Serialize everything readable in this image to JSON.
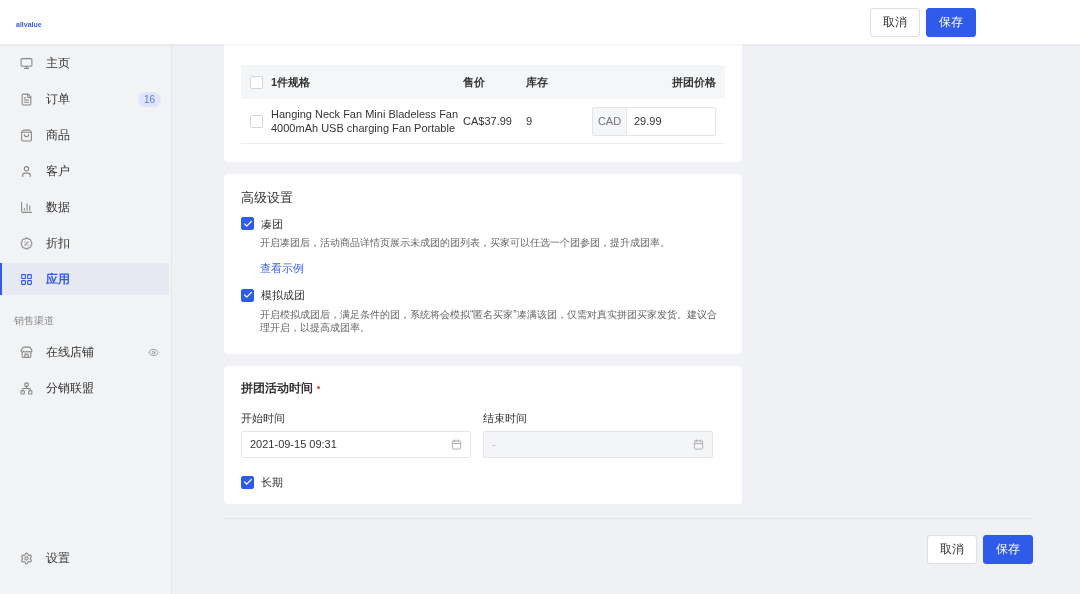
{
  "logo": "allvalue",
  "header_buttons": [
    {
      "label": "取消",
      "kind": "secondary"
    },
    {
      "label": "保存",
      "kind": "primary"
    }
  ],
  "sidebar": {
    "items": [
      {
        "label": "主页",
        "selected": false
      },
      {
        "label": "订单",
        "selected": false,
        "badge": "16"
      },
      {
        "label": "商品",
        "selected": false
      },
      {
        "label": "客户",
        "selected": false
      },
      {
        "label": "数据",
        "selected": false
      },
      {
        "label": "折扣",
        "selected": false
      },
      {
        "label": "应用",
        "selected": true
      }
    ],
    "section_label": "销售渠道",
    "channels": [
      {
        "label": "在线店铺",
        "visible_toggle": true
      },
      {
        "label": "分销联盟",
        "visible_toggle": false
      }
    ],
    "settings": "设置"
  },
  "price_table": {
    "columns": [
      "1件规格",
      "售价",
      "库存",
      "拼团价格"
    ],
    "header_checked": false,
    "rows": [
      {
        "checked": false,
        "name": "Hanging Neck Fan Mini Bladeless Fan 4000mAh USB charging Fan Portable",
        "price": "CA$37.99",
        "stock": "9",
        "currency": "CAD",
        "group_price": "29.99"
      }
    ]
  },
  "advanced": {
    "title": "高级设置",
    "options": [
      {
        "label": "凑团",
        "checked": true,
        "description": "开启凑团后，活动商品详情页展示未成团的团列表，买家可以任选一个团参团，提升成团率。",
        "link": "查看示例"
      },
      {
        "label": "模拟成团",
        "checked": true,
        "description": "开启模拟成团后，满足条件的团，系统将会模拟“匿名买家”凑满该团，仅需对真实拼团买家发货。建议合理开启，以提高成团率。"
      }
    ]
  },
  "schedule": {
    "title": "拼团活动时间",
    "required": true,
    "start_label": "开始时间",
    "start_value": "2021-09-15 09:31",
    "end_label": "结束时间",
    "end_value": "-",
    "end_disabled": true,
    "long_term": {
      "label": "长期",
      "checked": true
    }
  },
  "footer_buttons": [
    {
      "label": "取消",
      "kind": "secondary"
    },
    {
      "label": "保存",
      "kind": "primary"
    }
  ]
}
